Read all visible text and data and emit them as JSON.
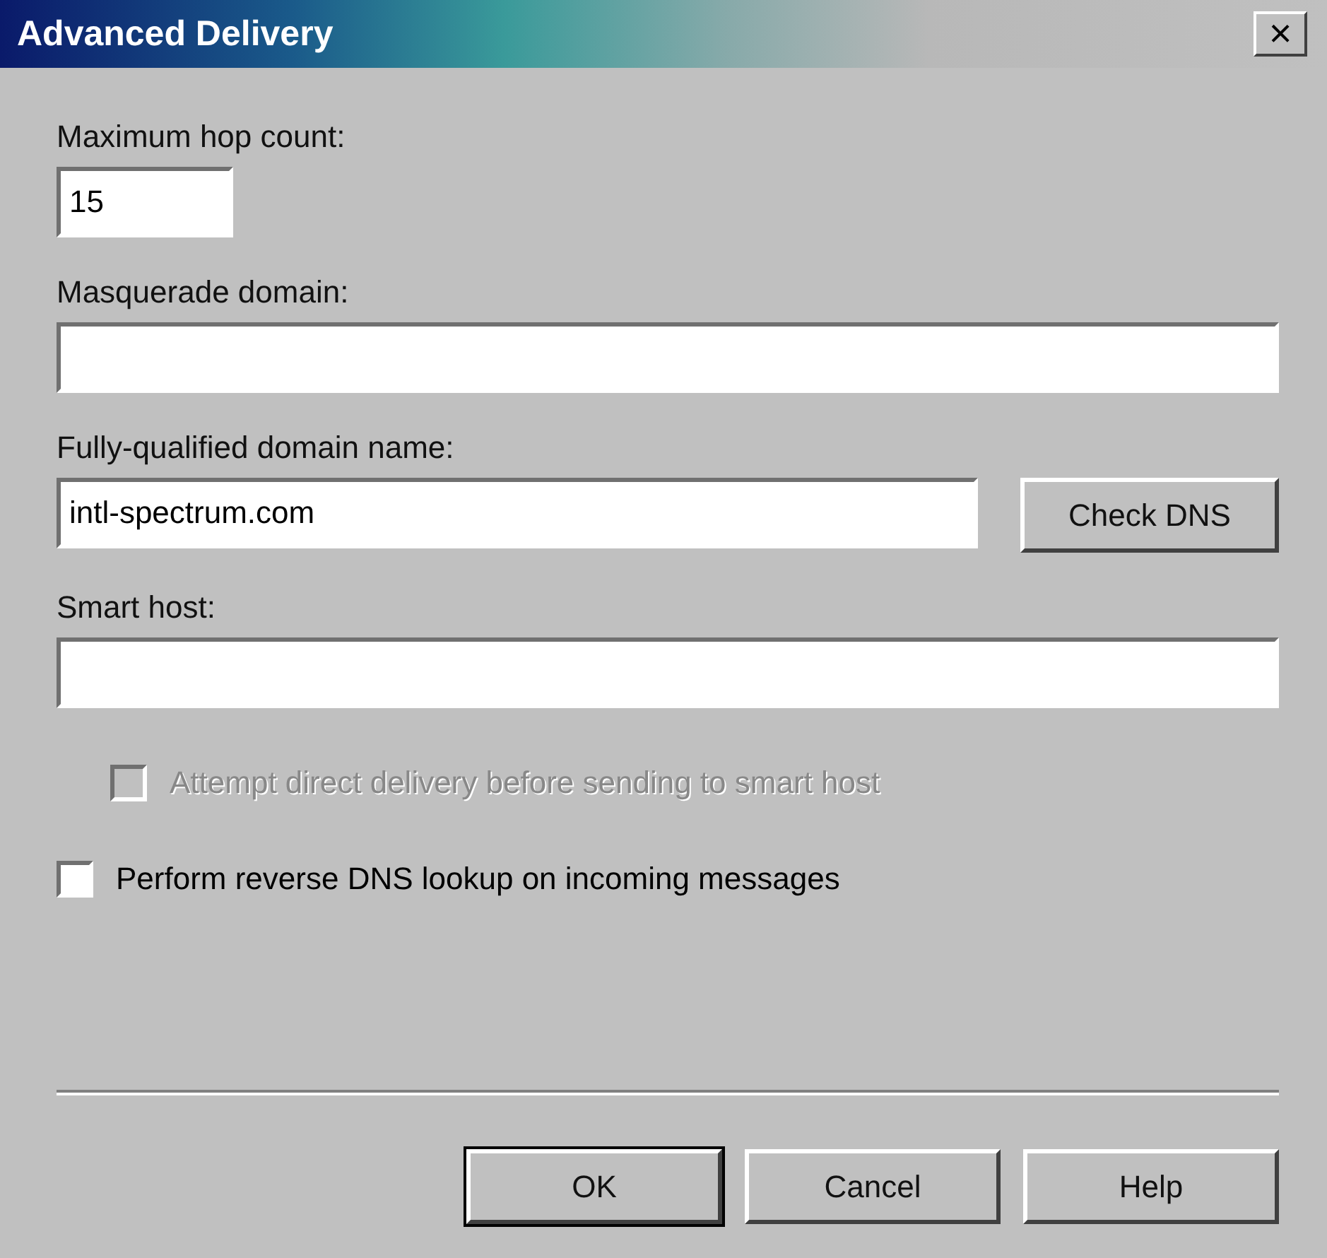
{
  "window": {
    "title": "Advanced Delivery",
    "close_label": "×"
  },
  "fields": [
    {
      "label": "Maximum hop count:",
      "value": "15",
      "kind": "short"
    },
    {
      "label": "Masquerade domain:",
      "kind": "wide"
    },
    {
      "label": "Fully-qualified domain name:",
      "value": "intl-spectrum.com",
      "kind": "button",
      "button": "Check DNS"
    },
    {
      "label": "Smart host:",
      "kind": "wide"
    }
  ],
  "checkboxes": [
    {
      "label": "Attempt direct delivery before sending to smart host",
      "checked": false,
      "disabled": true,
      "indented": true
    },
    {
      "label": "Perform reverse DNS lookup on incoming messages",
      "checked": false,
      "disabled": false,
      "indented": false
    }
  ],
  "buttons": [
    {
      "label": "OK",
      "default": true
    },
    {
      "label": "Cancel",
      "default": false
    },
    {
      "label": "Help",
      "default": false
    }
  ]
}
